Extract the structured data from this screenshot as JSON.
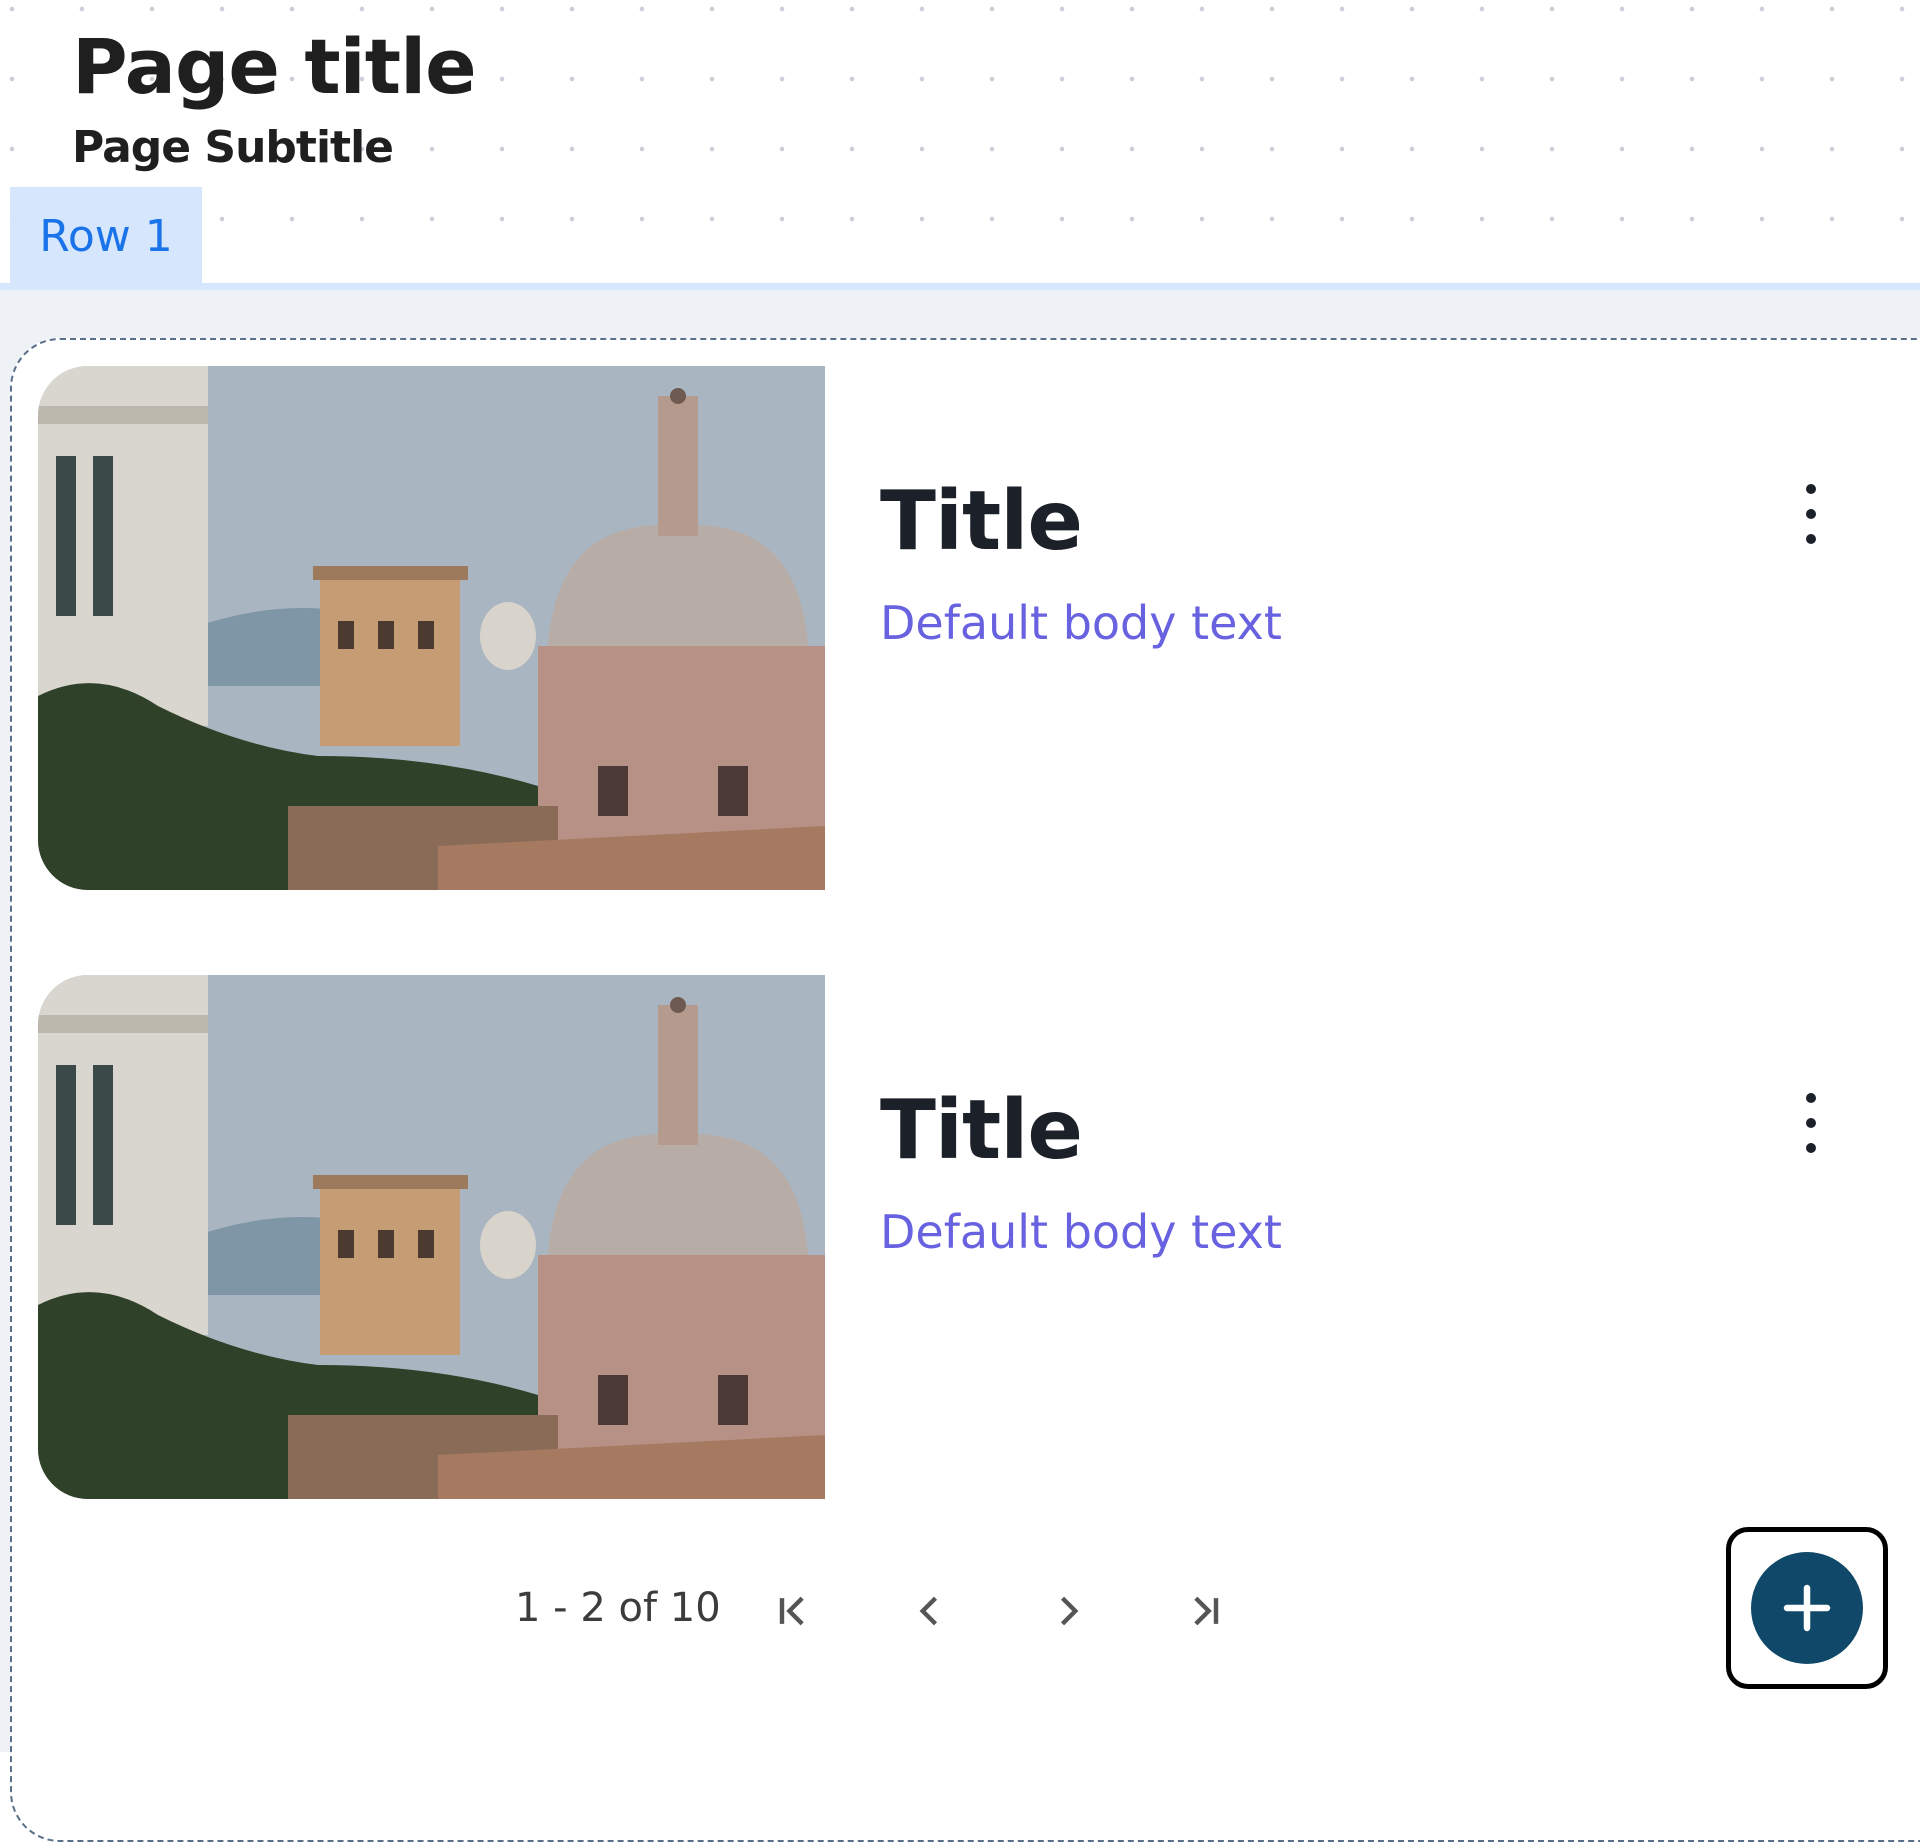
{
  "header": {
    "title": "Page title",
    "subtitle": "Page Subtitle"
  },
  "tabs": [
    {
      "label": "Row 1",
      "active": true
    }
  ],
  "colors": {
    "accent": "#1a73e8",
    "tab_bg": "#d6e6fc",
    "body_text": "#6962e0",
    "fab": "#0f4868"
  },
  "items": [
    {
      "title": "Title",
      "body": "Default body text",
      "image": "rome-domes-photo",
      "menu_icon": "kebab-icon"
    },
    {
      "title": "Title",
      "body": "Default body text",
      "image": "rome-domes-photo",
      "menu_icon": "kebab-icon"
    }
  ],
  "pagination": {
    "range": "1 - 2 of 10",
    "icons": [
      "first-page-icon",
      "prev-page-icon",
      "next-page-icon",
      "last-page-icon"
    ]
  },
  "fab": {
    "icon": "plus-icon"
  }
}
